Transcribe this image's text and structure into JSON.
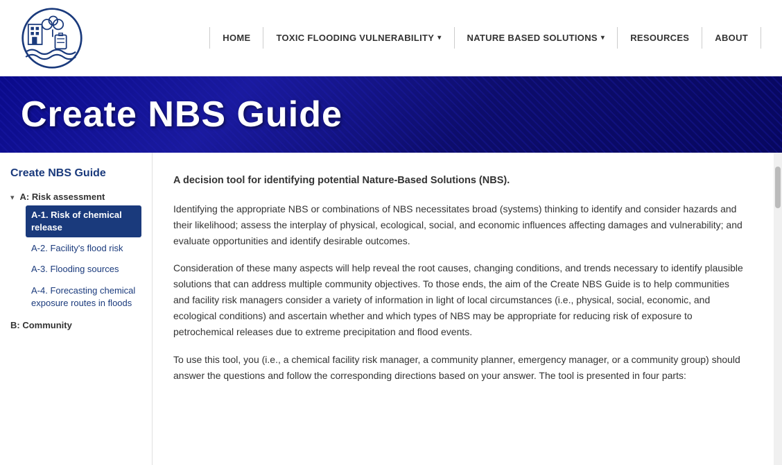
{
  "header": {
    "logo_alt": "NBS Flooding Tool Logo"
  },
  "nav": {
    "items": [
      {
        "label": "HOME",
        "has_dropdown": false
      },
      {
        "label": "TOXIC FLOODING VULNERABILITY",
        "has_dropdown": true
      },
      {
        "label": "NATURE BASED SOLUTIONS",
        "has_dropdown": true
      },
      {
        "label": "RESOURCES",
        "has_dropdown": false
      },
      {
        "label": "ABOUT",
        "has_dropdown": false
      }
    ]
  },
  "hero": {
    "title": "Create NBS Guide"
  },
  "sidebar": {
    "title": "Create NBS Guide",
    "section_a": {
      "label": "A: Risk assessment",
      "items": [
        {
          "id": "a1",
          "label": "A-1. Risk of chemical release",
          "active": true
        },
        {
          "id": "a2",
          "label": "A-2. Facility's flood risk",
          "active": false
        },
        {
          "id": "a3",
          "label": "A-3. Flooding sources",
          "active": false
        },
        {
          "id": "a4",
          "label": "A-4. Forecasting chemical exposure routes in floods",
          "active": false
        }
      ]
    },
    "section_b": {
      "label": "B: Community"
    }
  },
  "content": {
    "intro": "A decision tool for identifying potential Nature-Based Solutions (NBS).",
    "para1": "Identifying the appropriate NBS or combinations of NBS necessitates broad (systems) thinking to identify and consider hazards and their likelihood; assess the interplay of physical, ecological, social, and economic influences affecting damages and vulnerability; and evaluate opportunities and identify desirable outcomes.",
    "para2": "Consideration of these many aspects will help reveal the root causes, changing conditions, and trends necessary to identify plausible solutions that can address multiple community objectives. To those ends, the aim of the Create NBS Guide is to help communities and facility risk managers consider a variety of information in light of local circumstances (i.e., physical, social, economic, and ecological conditions) and ascertain whether and which types of NBS may be appropriate for reducing risk of exposure to petrochemical releases due to extreme precipitation and flood events.",
    "para3": "To use this tool, you (i.e., a chemical facility risk manager, a community planner, emergency manager, or a community group) should answer the questions and follow the corresponding directions based on your answer. The tool is presented in four parts:"
  }
}
